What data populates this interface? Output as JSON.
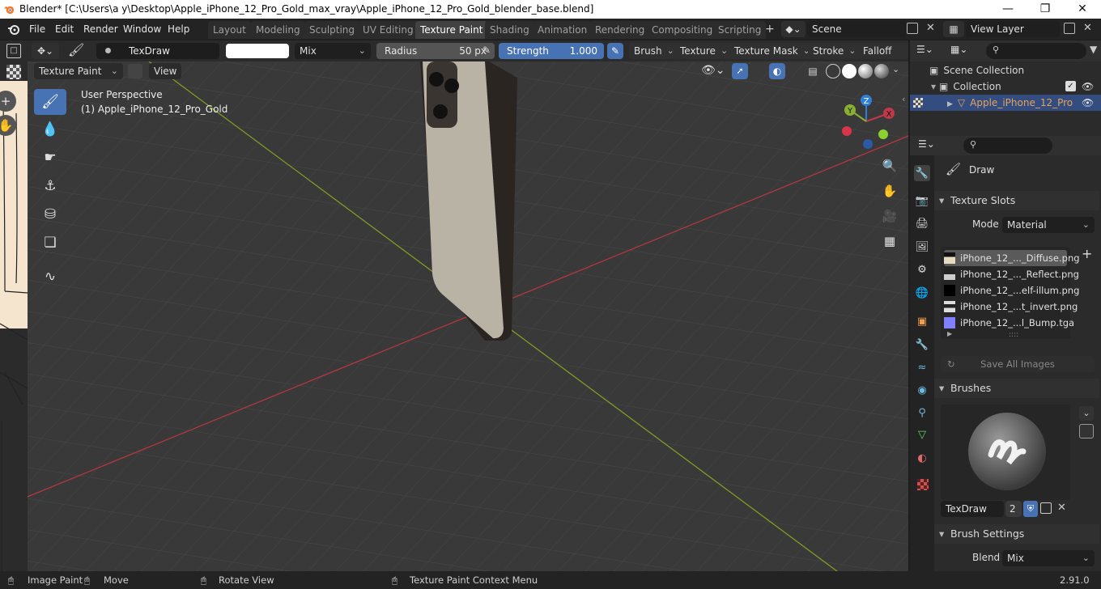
{
  "window": {
    "title": "Blender* [C:\\Users\\a y\\Desktop\\Apple_iPhone_12_Pro_Gold_max_vray\\Apple_iPhone_12_Pro_Gold_blender_base.blend]"
  },
  "menu": [
    "File",
    "Edit",
    "Render",
    "Window",
    "Help"
  ],
  "workspaces": [
    "Layout",
    "Modeling",
    "Sculpting",
    "UV Editing",
    "Texture Paint",
    "Shading",
    "Animation",
    "Rendering",
    "Compositing",
    "Scripting"
  ],
  "active_workspace": "Texture Paint",
  "scene": {
    "name": "Scene",
    "view_layer": "View Layer"
  },
  "tool_header": {
    "brush_name": "TexDraw",
    "blend_mode": "Mix",
    "radius_label": "Radius",
    "radius_value": "50 px",
    "strength_label": "Strength",
    "strength_value": "1.000",
    "strength_fraction": 1.0,
    "menus": [
      "Brush",
      "Texture",
      "Texture Mask",
      "Stroke",
      "Falloff"
    ],
    "brush_color": "#ffffff"
  },
  "viewport_header": {
    "mode": "Texture Paint",
    "view": "View"
  },
  "viewport": {
    "perspective": "User Perspective",
    "object_label": "(1) Apple_iPhone_12_Pro_Gold"
  },
  "gizmo": {
    "x": "X",
    "y": "Y",
    "z": "Z"
  },
  "outliner": {
    "scene_collection": "Scene Collection",
    "collection": "Collection",
    "object": "Apple_iPhone_12_Pro"
  },
  "properties": {
    "tool_name": "Draw",
    "texture_slots": {
      "title": "Texture Slots",
      "mode_label": "Mode",
      "mode_value": "Material",
      "slots": [
        "iPhone_12_..._Diffuse.png",
        "iPhone_12_..._Reflect.png",
        "iPhone_12_...elf-illum.png",
        "iPhone_12_...t_invert.png",
        "iPhone_12_...l_Bump.tga"
      ],
      "save_all": "Save All Images"
    },
    "brushes": {
      "title": "Brushes",
      "name": "TexDraw",
      "users": "2"
    },
    "brush_settings": {
      "title": "Brush Settings",
      "blend_label": "Blend",
      "blend_value": "Mix"
    }
  },
  "statusbar": {
    "image_paint": "Image Paint",
    "move": "Move",
    "rotate": "Rotate View",
    "context_menu": "Texture Paint Context Menu",
    "version": "2.91.0"
  },
  "colors": {
    "accent": "#4772b3",
    "x_axis": "#c0394a",
    "y_axis": "#8ab02f",
    "z_axis": "#2f7fd6",
    "selected": "#5f86d6"
  }
}
